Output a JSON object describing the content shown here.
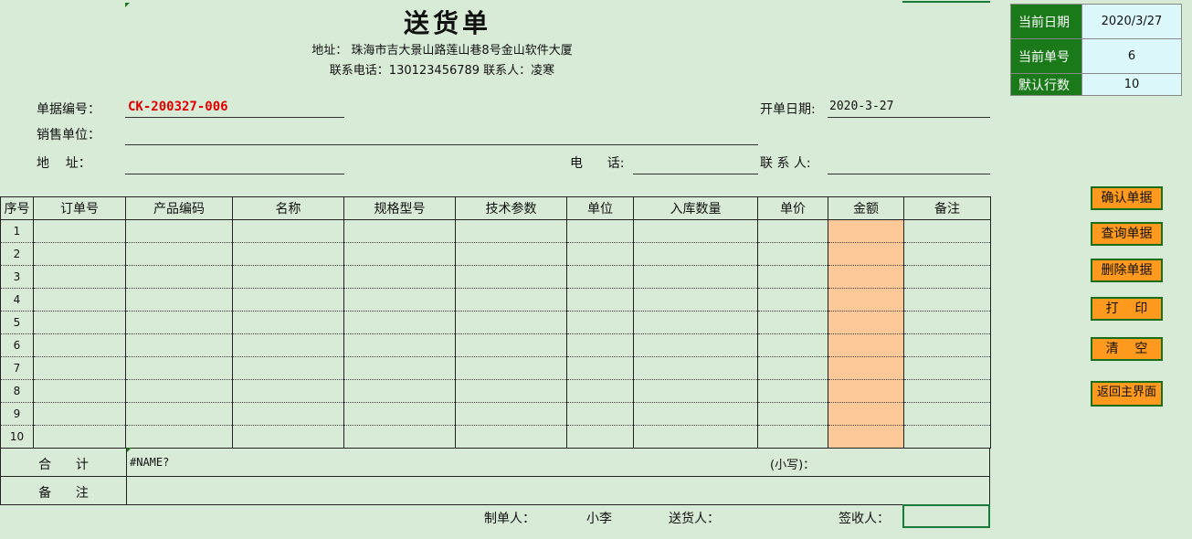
{
  "doc": {
    "title": "送货单",
    "address_line": "地址： 珠海市吉大景山路莲山巷8号金山软件大厦",
    "contact_line": "联系电话：130123456789   联系人：凌寒"
  },
  "header": {
    "doc_no_label": "单据编号：",
    "doc_no_value": "CK-200327-006",
    "date_label": "开单日期:",
    "date_value": "2020-3-27",
    "unit_label": "销售单位：",
    "addr_label": "地    址：",
    "phone_label": "电      话:",
    "contact_label": "联 系 人:"
  },
  "info_panel": {
    "current_date_label": "当前日期",
    "current_date_value": "2020/3/27",
    "current_no_label": "当前单号",
    "current_no_value": "6",
    "default_rows_label": "默认行数",
    "default_rows_value": "10"
  },
  "table": {
    "columns": [
      "序号",
      "订单号",
      "产品编码",
      "名称",
      "规格型号",
      "技术参数",
      "单位",
      "入库数量",
      "单价",
      "金额",
      "备注"
    ],
    "rows": [
      "1",
      "2",
      "3",
      "4",
      "5",
      "6",
      "7",
      "8",
      "9",
      "10"
    ]
  },
  "summary": {
    "total_label": "合      计",
    "total_value": "#NAME?",
    "lower_label": "(小写)：",
    "note_label": "备      注"
  },
  "footer": {
    "maker_label": "制单人：",
    "maker_value": "小李",
    "sender_label": "送货人：",
    "receiver_label": "签收人："
  },
  "buttons": {
    "confirm": "确认单据",
    "query": "查询单据",
    "delete": "删除单据",
    "print": "打    印",
    "clear": "清    空",
    "back": "返回主界面"
  },
  "colors": {
    "background": "#d8ebd6",
    "button": "#ff9a1f",
    "panel_key": "#1a7a1a",
    "panel_value": "#dcf8fa",
    "amount_column": "#fcc897",
    "doc_no": "#e00000"
  }
}
